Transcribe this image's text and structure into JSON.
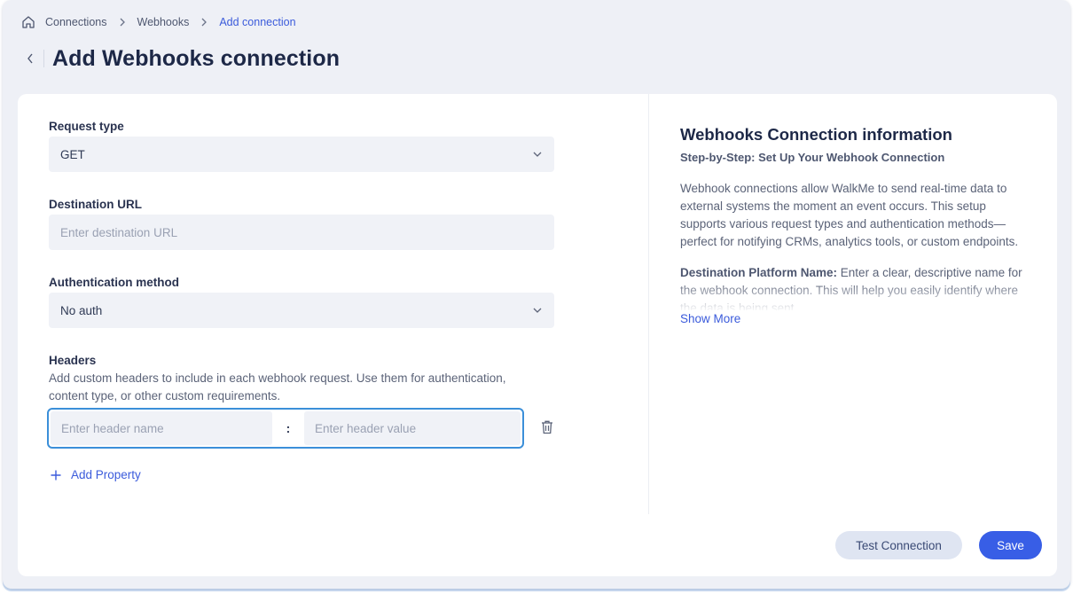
{
  "breadcrumb": {
    "home_icon": "home-icon",
    "items": [
      "Connections",
      "Webhooks",
      "Add connection"
    ]
  },
  "page": {
    "title": "Add Webhooks connection",
    "back_icon": "chevron-left-icon"
  },
  "form": {
    "request_type": {
      "label": "Request type",
      "value": "GET"
    },
    "destination_url": {
      "label": "Destination URL",
      "placeholder": "Enter destination URL",
      "value": ""
    },
    "auth_method": {
      "label": "Authentication method",
      "value": "No auth"
    },
    "headers": {
      "label": "Headers",
      "description": "Add custom headers to include in each webhook request. Use them for authentication, content type, or other custom requirements.",
      "name_placeholder": "Enter header name",
      "separator": ":",
      "value_placeholder": "Enter header value"
    },
    "add_property_label": "Add Property"
  },
  "info": {
    "title": "Webhooks Connection information",
    "subtitle": "Step-by-Step: Set Up Your Webhook Connection",
    "paragraph": "Webhook connections allow WalkMe to send real-time data to external systems the moment an event occurs. This setup supports various request types and authentication methods—perfect for notifying CRMs, analytics tools, or custom endpoints.",
    "platform_name_label": "Destination Platform Name:",
    "platform_name_text": "Enter a clear, descriptive name for the webhook connection. This will help you easily identify where the data is being sent.",
    "show_more": "Show More"
  },
  "actions": {
    "test_label": "Test Connection",
    "save_label": "Save"
  },
  "colors": {
    "accent": "#385ee6",
    "link": "#3b5bdb",
    "focus_border": "#3b8fd9",
    "background": "#eef0f6"
  }
}
